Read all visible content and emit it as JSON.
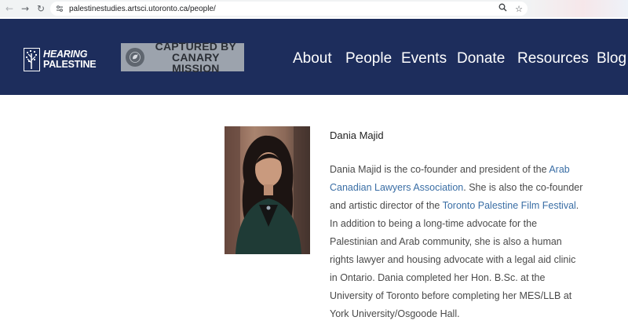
{
  "browser": {
    "url": "palestinestudies.artsci.utoronto.ca/people/",
    "back_icon": "arrow-left-icon",
    "forward_icon": "arrow-right-icon",
    "reload_icon": "reload-icon",
    "zoom_icon": "magnifier-icon",
    "star_icon": "star-icon"
  },
  "header": {
    "bg_color": "#1d2d5c",
    "logo": {
      "line1": "HEARING",
      "line2": "PALESTINE"
    },
    "badge": {
      "line1": "CAPTURED BY",
      "line2": "CANARY MISSION"
    },
    "nav": [
      "About",
      "People",
      "Events",
      "Donate",
      "Resources",
      "Blog"
    ]
  },
  "person": {
    "name": "Dania Majid",
    "bio_lines": [
      [
        {
          "t": "Dania Majid is the co-founder and president of the "
        },
        {
          "t": "Arab",
          "link": true
        }
      ],
      [
        {
          "t": "Canadian Lawyers Association",
          "link": true
        },
        {
          "t": ". She is also the co-founder"
        }
      ],
      [
        {
          "t": "and artistic director of the "
        },
        {
          "t": "Toronto Palestine Film Festival",
          "link": true
        },
        {
          "t": "."
        }
      ],
      [
        {
          "t": "In addition to being a long-time advocate for the"
        }
      ],
      [
        {
          "t": "Palestinian and Arab community, she is also a human"
        }
      ],
      [
        {
          "t": "rights lawyer and housing advocate with a legal aid clinic"
        }
      ],
      [
        {
          "t": "in Ontario. Dania completed her Hon. B.Sc. at the"
        }
      ],
      [
        {
          "t": "University of Toronto before completing her MES/LLB at"
        }
      ],
      [
        {
          "t": "York University/Osgoode Hall."
        }
      ]
    ],
    "link_color": "#3a6ea5"
  }
}
